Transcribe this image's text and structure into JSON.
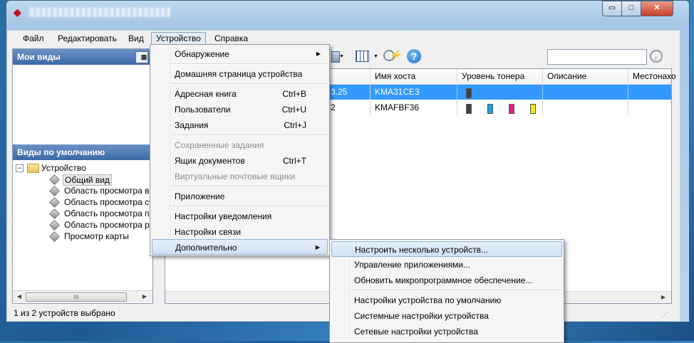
{
  "window": {
    "app_icon": "kyocera-logo-icon",
    "title": ""
  },
  "titlebar_buttons": {
    "minimize": "▭",
    "maximize": "□",
    "close": "✕"
  },
  "menubar": {
    "items": [
      "Файл",
      "Редактировать",
      "Вид",
      "Устройство",
      "Справка"
    ]
  },
  "left_panel": {
    "my_views_title": "Мои виды",
    "default_views_title": "Виды по умолчанию",
    "tree_root": "Устройство",
    "tree_items": [
      "Общий вид",
      "Область просмотра воз",
      "Область просмотра сче",
      "Область просмотра про",
      "Область просмотра рес",
      "Просмотр карты"
    ],
    "scroll_thumb": "III"
  },
  "table": {
    "columns": [
      "Имя хоста",
      "Уровень тонера",
      "Описание",
      "Местонахо"
    ],
    "rows": [
      {
        "ip_fragment": "3.25",
        "host": "KMA31CE3",
        "toner": [
          "#404040"
        ]
      },
      {
        "ip_fragment": "2",
        "host": "KMAFBF36",
        "toner": [
          "#404040",
          "#1aa3e0",
          "#e0208a",
          "#f3e31c"
        ]
      }
    ]
  },
  "device_menu": {
    "items": [
      {
        "label": "Обнаружение",
        "shortcut": "",
        "submenu": true,
        "enabled": true
      },
      {
        "label": "Домашняя страница устройства",
        "shortcut": "",
        "submenu": false,
        "enabled": true
      },
      {
        "label": "Адресная книга",
        "shortcut": "Ctrl+B",
        "submenu": false,
        "enabled": true
      },
      {
        "label": "Пользователи",
        "shortcut": "Ctrl+U",
        "submenu": false,
        "enabled": true
      },
      {
        "label": "Задания",
        "shortcut": "Ctrl+J",
        "submenu": false,
        "enabled": true
      },
      {
        "label": "Сохраненные задания",
        "shortcut": "",
        "submenu": false,
        "enabled": false
      },
      {
        "label": "Ящик документов",
        "shortcut": "Ctrl+T",
        "submenu": false,
        "enabled": true
      },
      {
        "label": "Виртуальные почтовые ящики",
        "shortcut": "",
        "submenu": false,
        "enabled": false
      },
      {
        "label": "Приложение",
        "shortcut": "",
        "submenu": false,
        "enabled": true
      },
      {
        "label": "Настройки уведомления",
        "shortcut": "",
        "submenu": false,
        "enabled": true
      },
      {
        "label": "Настройки связи",
        "shortcut": "",
        "submenu": false,
        "enabled": true
      },
      {
        "label": "Дополнительно",
        "shortcut": "",
        "submenu": true,
        "enabled": true
      }
    ]
  },
  "sub_menu": {
    "items": [
      "Настроить несколько устройств...",
      "Управление приложениями...",
      "Обновить микропрограммное обеспечение...",
      "Настройки устройства по умолчанию",
      "Системные настройки устройства",
      "Сетевые настройки устройства"
    ]
  },
  "statusbar": {
    "text": "1 из 2 устройств выбрано"
  },
  "colors": {
    "selection": "#3399ff",
    "menu_highlight": "#cfe1f6",
    "header_gradient": "#3b69a6"
  }
}
